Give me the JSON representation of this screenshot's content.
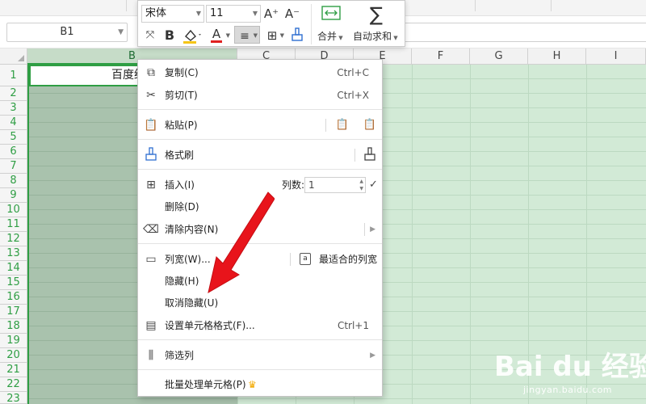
{
  "name_box": {
    "value": "B1"
  },
  "mini_toolbar": {
    "font_name": "宋体",
    "font_size": "11",
    "grow_font_icon": "A⁺",
    "shrink_font_icon": "A⁻",
    "bold_label": "B",
    "font_color_glyph": "A",
    "merge_label": "合并",
    "autosum_label": "自动求和",
    "colors": {
      "fill_accent": "#f5c518",
      "font_color_accent": "#e02020"
    }
  },
  "grid": {
    "columns": [
      "B",
      "C",
      "D",
      "E",
      "F",
      "G",
      "H",
      "I"
    ],
    "selected_column": "B",
    "rows": [
      "1",
      "2",
      "3",
      "4",
      "5",
      "6",
      "7",
      "8",
      "9",
      "10",
      "11",
      "12",
      "13",
      "14",
      "15",
      "16",
      "17",
      "18",
      "19",
      "20",
      "21",
      "22",
      "23"
    ],
    "b1_value": "百度经"
  },
  "context_menu": {
    "copy": {
      "label": "复制(C)",
      "shortcut": "Ctrl+C"
    },
    "cut": {
      "label": "剪切(T)",
      "shortcut": "Ctrl+X"
    },
    "paste": {
      "label": "粘贴(P)"
    },
    "format_painter": {
      "label": "格式刷"
    },
    "insert": {
      "label": "插入(I)",
      "count_label": "列数:",
      "count_value": "1"
    },
    "delete": {
      "label": "删除(D)"
    },
    "clear": {
      "label": "清除内容(N)"
    },
    "column_width": {
      "label": "列宽(W)...",
      "best_fit_label": "最适合的列宽"
    },
    "hide": {
      "label": "隐藏(H)"
    },
    "unhide": {
      "label": "取消隐藏(U)"
    },
    "format_cells": {
      "label": "设置单元格格式(F)...",
      "shortcut": "Ctrl+1"
    },
    "filter_column": {
      "label": "筛选列"
    },
    "batch": {
      "label": "批量处理单元格(P)"
    }
  },
  "annotation": {
    "arrow_color": "#e8141b"
  },
  "watermark": {
    "logo_text": "Bai du 经验",
    "url": "jingyan.baidu.com"
  },
  "theme": {
    "selection_green": "#2f9e44",
    "cell_fill": "#d2ead6"
  }
}
